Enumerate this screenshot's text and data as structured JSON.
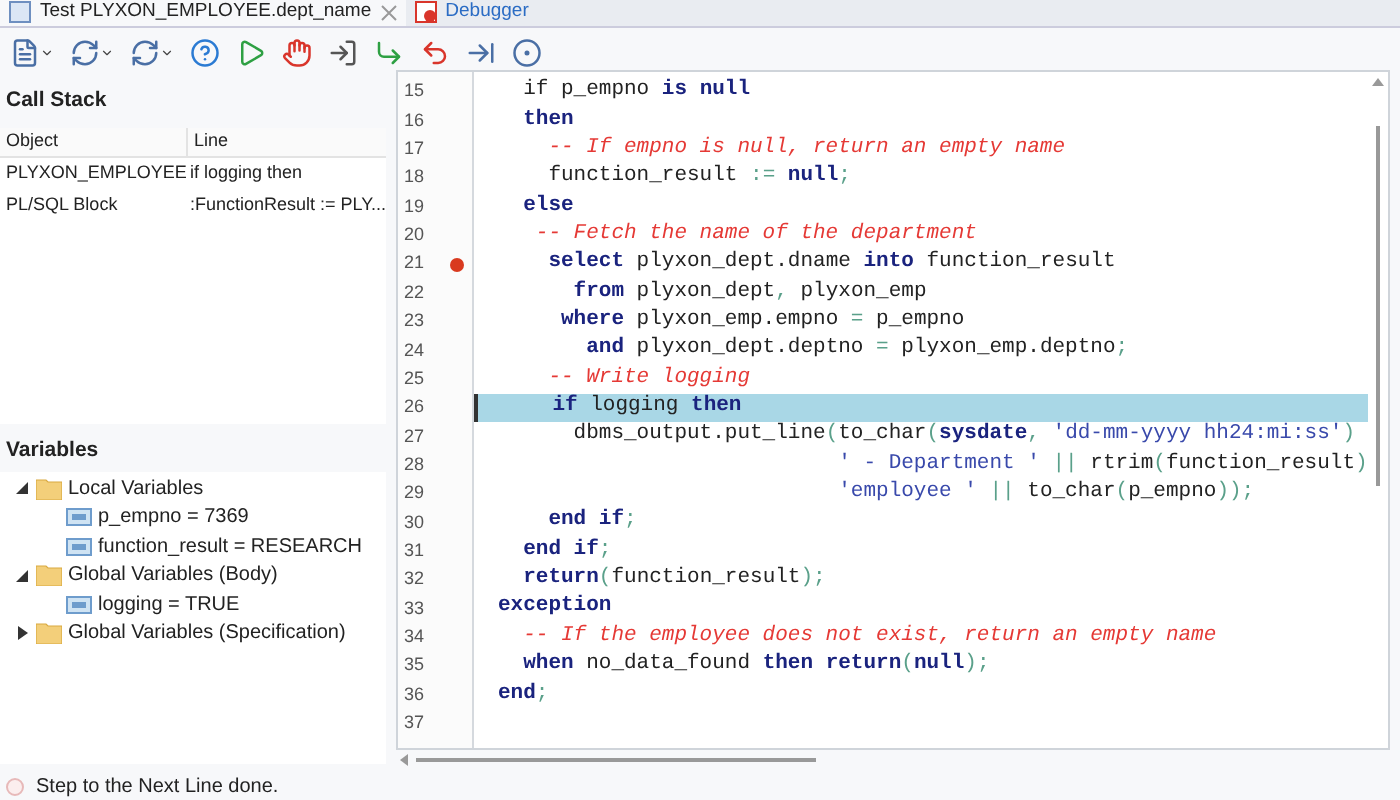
{
  "tabs": [
    {
      "label": "Test PLYXON_EMPLOYEE.dept_name",
      "selected": true,
      "closable": true
    },
    {
      "label": "Debugger",
      "selected": false,
      "closable": false
    }
  ],
  "call_stack": {
    "title": "Call Stack",
    "columns": [
      "Object",
      "Line"
    ],
    "rows": [
      [
        "PLYXON_EMPLOYEE",
        "if logging then"
      ],
      [
        "PL/SQL Block",
        ":FunctionResult := PLY..."
      ]
    ]
  },
  "variables": {
    "title": "Variables",
    "items": [
      {
        "label": "Local Variables",
        "kind": "folder",
        "expanded": true,
        "children": [
          {
            "label": "p_empno = 7369",
            "kind": "variable"
          },
          {
            "label": "function_result = RESEARCH",
            "kind": "variable"
          }
        ]
      },
      {
        "label": "Global Variables (Body)",
        "kind": "folder",
        "expanded": true,
        "children": [
          {
            "label": "logging = TRUE",
            "kind": "variable"
          }
        ]
      },
      {
        "label": "Global Variables (Specification)",
        "kind": "folder",
        "expanded": false
      }
    ]
  },
  "editor": {
    "lines": [
      {
        "number": "15",
        "breakpoint": false,
        "current": false,
        "tokens": [
          {
            "t": "  if ",
            "kind": "plain"
          },
          {
            "t": "p_empno ",
            "kind": "plain"
          },
          {
            "t": "is null",
            "kind": "keyword"
          }
        ]
      },
      {
        "number": "16",
        "breakpoint": false,
        "current": false,
        "tokens": [
          {
            "t": "  then",
            "kind": "keyword"
          }
        ]
      },
      {
        "number": "17",
        "breakpoint": false,
        "current": false,
        "tokens": [
          {
            "t": "    -- If empno is null, return an empty name",
            "kind": "comment"
          }
        ]
      },
      {
        "number": "18",
        "breakpoint": false,
        "current": false,
        "tokens": [
          {
            "t": "    function_result ",
            "kind": "plain"
          },
          {
            "t": ":=",
            "kind": "operator"
          },
          {
            "t": " null",
            "kind": "keyword"
          },
          {
            "t": ";",
            "kind": "operator"
          }
        ]
      },
      {
        "number": "19",
        "breakpoint": false,
        "current": false,
        "tokens": [
          {
            "t": "  else",
            "kind": "keyword"
          }
        ]
      },
      {
        "number": "20",
        "breakpoint": false,
        "current": false,
        "tokens": [
          {
            "t": "   -- Fetch the name of the department",
            "kind": "comment"
          }
        ]
      },
      {
        "number": "21",
        "breakpoint": true,
        "current": false,
        "tokens": [
          {
            "t": "    select",
            "kind": "keyword"
          },
          {
            "t": " plyxon_dept.dname ",
            "kind": "plain"
          },
          {
            "t": "into",
            "kind": "keyword"
          },
          {
            "t": " function_result",
            "kind": "plain"
          }
        ]
      },
      {
        "number": "22",
        "breakpoint": false,
        "current": false,
        "tokens": [
          {
            "t": "      from",
            "kind": "keyword"
          },
          {
            "t": " plyxon_dept",
            "kind": "plain"
          },
          {
            "t": ",",
            "kind": "operator"
          },
          {
            "t": " plyxon_emp",
            "kind": "plain"
          }
        ]
      },
      {
        "number": "23",
        "breakpoint": false,
        "current": false,
        "tokens": [
          {
            "t": "     where",
            "kind": "keyword"
          },
          {
            "t": " plyxon_emp.empno ",
            "kind": "plain"
          },
          {
            "t": "=",
            "kind": "operator"
          },
          {
            "t": " p_empno",
            "kind": "plain"
          }
        ]
      },
      {
        "number": "24",
        "breakpoint": false,
        "current": false,
        "tokens": [
          {
            "t": "       and",
            "kind": "keyword"
          },
          {
            "t": " plyxon_dept.deptno ",
            "kind": "plain"
          },
          {
            "t": "=",
            "kind": "operator"
          },
          {
            "t": " plyxon_emp.deptno",
            "kind": "plain"
          },
          {
            "t": ";",
            "kind": "operator"
          }
        ]
      },
      {
        "number": "25",
        "breakpoint": false,
        "current": false,
        "tokens": [
          {
            "t": "    -- Write logging",
            "kind": "comment"
          }
        ]
      },
      {
        "number": "26",
        "breakpoint": false,
        "current": true,
        "tokens": [
          {
            "t": "    if",
            "kind": "keyword"
          },
          {
            "t": " logging ",
            "kind": "plain"
          },
          {
            "t": "then",
            "kind": "keyword"
          }
        ]
      },
      {
        "number": "27",
        "breakpoint": false,
        "current": false,
        "tokens": [
          {
            "t": "      dbms_output.put_line",
            "kind": "plain"
          },
          {
            "t": "(",
            "kind": "operator"
          },
          {
            "t": "to_char",
            "kind": "plain"
          },
          {
            "t": "(",
            "kind": "operator"
          },
          {
            "t": "sysdate",
            "kind": "keyword"
          },
          {
            "t": ", ",
            "kind": "operator"
          },
          {
            "t": "'dd-mm-yyyy hh24:mi:ss'",
            "kind": "string"
          },
          {
            "t": ")",
            "kind": "operator"
          }
        ]
      },
      {
        "number": "28",
        "breakpoint": false,
        "current": false,
        "tokens": [
          {
            "t": "                           ' - Department '",
            "kind": "string"
          },
          {
            "t": " || ",
            "kind": "operator"
          },
          {
            "t": "rtrim",
            "kind": "plain"
          },
          {
            "t": "(",
            "kind": "operator"
          },
          {
            "t": "function_result",
            "kind": "plain"
          },
          {
            "t": ")",
            "kind": "operator"
          }
        ]
      },
      {
        "number": "29",
        "breakpoint": false,
        "current": false,
        "tokens": [
          {
            "t": "                           'employee '",
            "kind": "string"
          },
          {
            "t": " || ",
            "kind": "operator"
          },
          {
            "t": "to_char",
            "kind": "plain"
          },
          {
            "t": "(",
            "kind": "operator"
          },
          {
            "t": "p_empno",
            "kind": "plain"
          },
          {
            "t": "));",
            "kind": "operator"
          }
        ]
      },
      {
        "number": "30",
        "breakpoint": false,
        "current": false,
        "tokens": [
          {
            "t": "    end if",
            "kind": "keyword"
          },
          {
            "t": ";",
            "kind": "operator"
          }
        ]
      },
      {
        "number": "31",
        "breakpoint": false,
        "current": false,
        "tokens": [
          {
            "t": "  end if",
            "kind": "keyword"
          },
          {
            "t": ";",
            "kind": "operator"
          }
        ]
      },
      {
        "number": "32",
        "breakpoint": false,
        "current": false,
        "tokens": [
          {
            "t": "  return",
            "kind": "keyword"
          },
          {
            "t": "(",
            "kind": "operator"
          },
          {
            "t": "function_result",
            "kind": "plain"
          },
          {
            "t": ");",
            "kind": "operator"
          }
        ]
      },
      {
        "number": "33",
        "breakpoint": false,
        "current": false,
        "tokens": [
          {
            "t": "exception",
            "kind": "keyword"
          }
        ]
      },
      {
        "number": "34",
        "breakpoint": false,
        "current": false,
        "tokens": [
          {
            "t": "  -- If the employee does not exist, return an empty name",
            "kind": "comment"
          }
        ]
      },
      {
        "number": "35",
        "breakpoint": false,
        "current": false,
        "tokens": [
          {
            "t": "  when",
            "kind": "keyword"
          },
          {
            "t": " no_data_found ",
            "kind": "plain"
          },
          {
            "t": "then return",
            "kind": "keyword"
          },
          {
            "t": "(",
            "kind": "operator"
          },
          {
            "t": "null",
            "kind": "keyword"
          },
          {
            "t": ");",
            "kind": "operator"
          }
        ]
      },
      {
        "number": "36",
        "breakpoint": false,
        "current": false,
        "tokens": [
          {
            "t": "end",
            "kind": "keyword"
          },
          {
            "t": ";",
            "kind": "operator"
          }
        ]
      },
      {
        "number": "37",
        "breakpoint": false,
        "current": false
      }
    ]
  },
  "status_bar": {
    "text": "Step to the Next Line done."
  }
}
